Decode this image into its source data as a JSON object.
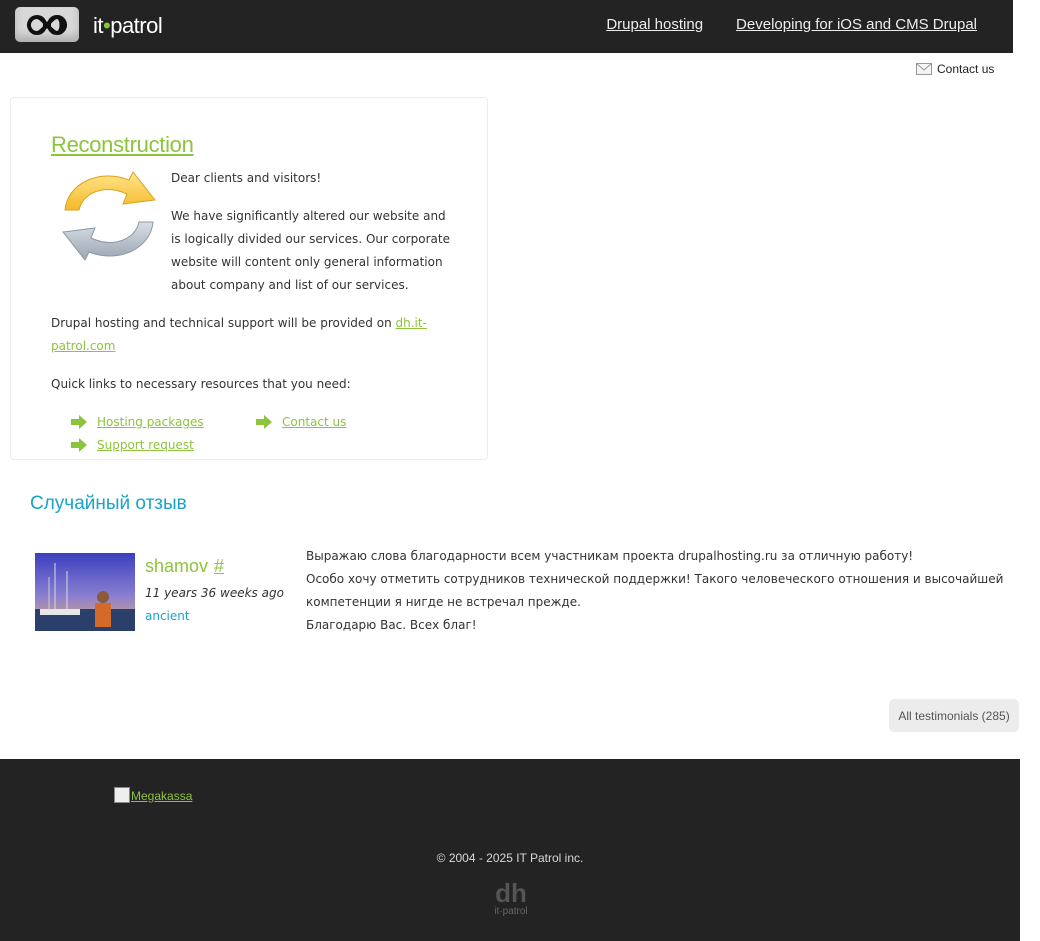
{
  "header": {
    "logo_text_left": "it",
    "logo_text_right": "patrol",
    "nav": [
      "Drupal hosting",
      "Developing for iOS and CMS Drupal"
    ]
  },
  "contact_top": "Contact us",
  "notice": {
    "title": "Reconstruction",
    "greeting": "Dear clients and visitors!",
    "paragraph1": "We have significantly altered our website and is logically divided our services. Our corporate website will content only general information about company and list of our services.",
    "paragraph2_text": "Drupal hosting and technical support will be provided on ",
    "paragraph2_link": "dh.it-patrol.com",
    "paragraph3": "Quick links to necessary resources that you need:",
    "quick_links": [
      "Hosting packages",
      "Contact us",
      "Support request"
    ]
  },
  "reviews": {
    "title": "Случайный отзыв",
    "author": "shamov",
    "permalink": "#",
    "time": "11 years 36 weeks ago",
    "badge": "ancient",
    "lines": [
      "Выражаю слова благодарности всем участникам проекта drupalhosting.ru за отличную работу!",
      "Особо хочу отметить сотрудников технической поддержки! Такого человеческого отношения и высочайшей компетенции я нигде не встречал прежде.",
      "Благодарю Вас. Всех благ!"
    ],
    "all_button": "All testimonials (285)"
  },
  "footer": {
    "megakassa": "Megakassa",
    "copyright": "© 2004 - 2025 IT Patrol inc.",
    "logo_big": "dh",
    "logo_small": "it·patrol"
  },
  "colors": {
    "accent_green": "#8cc43c",
    "accent_blue": "#1aa3c9",
    "dark": "#232323"
  }
}
